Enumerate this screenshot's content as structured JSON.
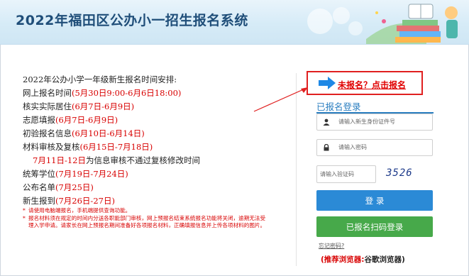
{
  "header": {
    "title": "2022年福田区公办小一招生报名系统"
  },
  "schedule": {
    "heading": "2022年公办小学一年级新生报名时间安排:",
    "items": [
      {
        "label": "网上报名时间",
        "value": "(5月30日9:00-6月6日18:00)"
      },
      {
        "label": "核实实际居住",
        "value": "(6月7日-6月9日)"
      },
      {
        "label": "志愿填报",
        "value": "(6月7日-6月9日)"
      },
      {
        "label": "初验报名信息",
        "value": "(6月10日-6月14日)"
      },
      {
        "label": "材料审核及复核",
        "value": "(6月15日-7月18日)"
      }
    ],
    "recheck_red": "7月11日-12日",
    "recheck_black": "为信息审核不通过复核修改时间",
    "items2": [
      {
        "label": "统筹学位",
        "value": "(7月19日-7月24日)"
      },
      {
        "label": "公布名单",
        "value": "(7月25日)"
      },
      {
        "label": "新生报到",
        "value": "(7月26日-27日)"
      }
    ]
  },
  "notes": [
    "请使用电脑端报名，手机端提供查询功能。",
    "报名材料须在规定的时间内分送各职能部门审核，网上预报名结束系统报名功能将关闭，逾期无法受理入学申请。请家长在网上预报名期间准备好各项报名材料，正确填报信息并上传各项材料的图片。"
  ],
  "register_link": "未报名？点击报名",
  "login": {
    "title": "已报名登录",
    "id_placeholder": "请输入新生身份证件号",
    "password_placeholder": "请输入密码",
    "captcha_placeholder": "请输入验证码",
    "captcha_code": "3526",
    "login_button": "登 录",
    "scan_button": "已报名扫码登录",
    "forgot": "忘记密码?",
    "browser_label": "(推荐浏览器:",
    "browser_value": "谷歌浏览器)"
  },
  "colors": {
    "accent": "#2b8ad6",
    "green": "#47a94a",
    "red": "#d80000",
    "title": "#1f4e79"
  }
}
